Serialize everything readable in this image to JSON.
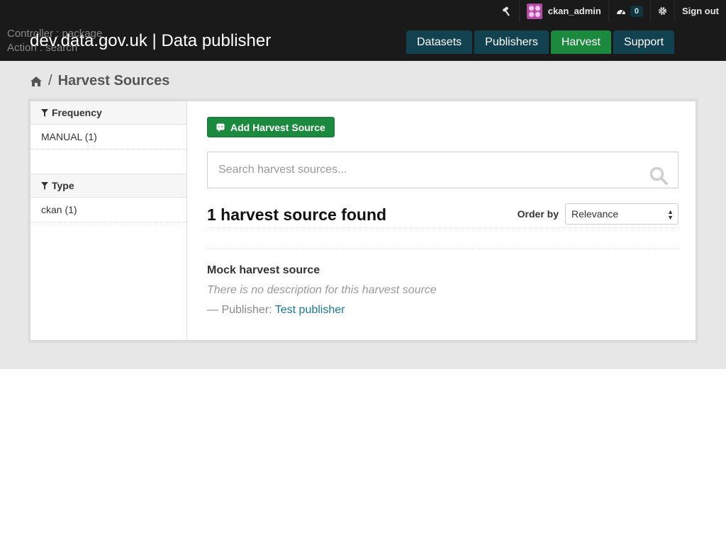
{
  "header": {
    "debug_controller": "Controller : package",
    "debug_action": "Action : search",
    "site_title": "dev.data.gov.uk | Data publisher",
    "account": {
      "username": "ckan_admin",
      "activity_count": "0",
      "sign_out": "Sign out"
    },
    "nav": [
      {
        "label": "Datasets",
        "active": false
      },
      {
        "label": "Publishers",
        "active": false
      },
      {
        "label": "Harvest",
        "active": true
      },
      {
        "label": "Support",
        "active": false
      }
    ]
  },
  "breadcrumb": {
    "separator": "/",
    "current": "Harvest Sources"
  },
  "facets": [
    {
      "title": "Frequency",
      "items": [
        "MANUAL (1)"
      ]
    },
    {
      "title": "Type",
      "items": [
        "ckan (1)"
      ]
    }
  ],
  "main": {
    "add_button": "Add Harvest Source",
    "search_placeholder": "Search harvest sources...",
    "result_count": "1 harvest source found",
    "order_by_label": "Order by",
    "order_by_value": "Relevance",
    "result": {
      "title": "Mock harvest source",
      "description": "There is no description for this harvest source",
      "publisher_prefix": "— Publisher:",
      "publisher_link": "Test publisher"
    }
  },
  "colors": {
    "masthead_bg": "#1a1a1a",
    "nav_bg": "#12414f",
    "nav_active_bg": "#1c8a3e",
    "primary_button": "#1c8a3e",
    "link": "#187794",
    "band_bg": "#e7e7e7"
  }
}
